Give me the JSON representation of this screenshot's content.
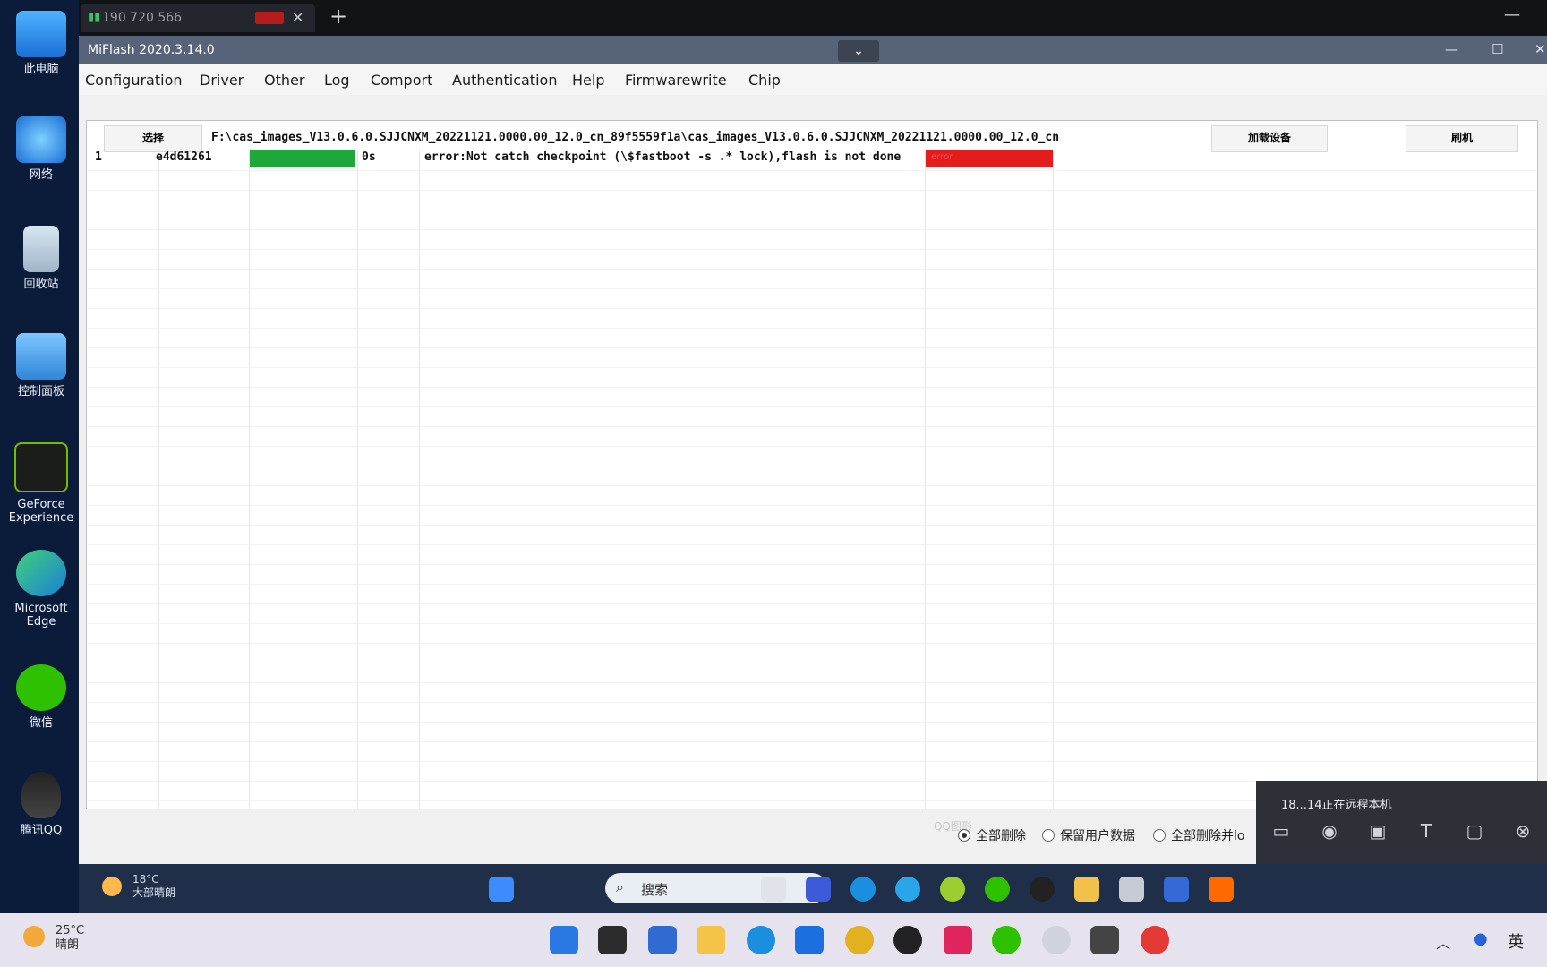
{
  "host": {
    "tab_number": "190 720 566",
    "tab_close": "✕",
    "new_tab": "+",
    "minimize": "—"
  },
  "desktop_icons": [
    "此电脑",
    "网络",
    "回收站",
    "控制面板",
    "GeForce Experience",
    "Microsoft Edge",
    "微信",
    "腾讯QQ"
  ],
  "window": {
    "title": "MiFlash 2020.3.14.0",
    "dropdown": "⌄",
    "controls": {
      "min": "—",
      "max": "☐",
      "close": "✕"
    }
  },
  "menu": [
    "Configuration",
    "Driver",
    "Other",
    "Log",
    "Comport",
    "Authentication",
    "Help",
    "Firmwarewrite",
    "Chip"
  ],
  "path": {
    "label": "选择",
    "value": "F:\\cas_images_V13.0.6.0.SJJCNXM_20221121.0000.00_12.0_cn_89f5559f1a\\cas_images_V13.0.6.0.SJJCNXM_20221121.0000.00_12.0_cn"
  },
  "buttons": {
    "refresh": "加载设备",
    "flash": "刷机"
  },
  "table": {
    "rows": [
      {
        "num": "1",
        "device": "e4d61261",
        "progress": 1.0,
        "time": "0s",
        "status": "error:Not catch checkpoint (\\$fastboot -s .* lock),flash is not done",
        "result": "error"
      }
    ]
  },
  "options": {
    "qq_hint": "QQ图形",
    "clean_all": "全部删除",
    "save_user_data": "保留用户数据",
    "clean_all_lock": "全部删除并lo"
  },
  "remote_popup": {
    "text": "18...14正在远程本机"
  },
  "inner_taskbar": {
    "temp": "18°C",
    "weather": "大部晴朗",
    "search": "搜索"
  },
  "host_taskbar": {
    "temp": "25°C",
    "weather": "晴朗",
    "lang": "英"
  },
  "colors": {
    "progress": "#1fa83a",
    "result": "#e51c1c",
    "title_bg": "#566378"
  }
}
